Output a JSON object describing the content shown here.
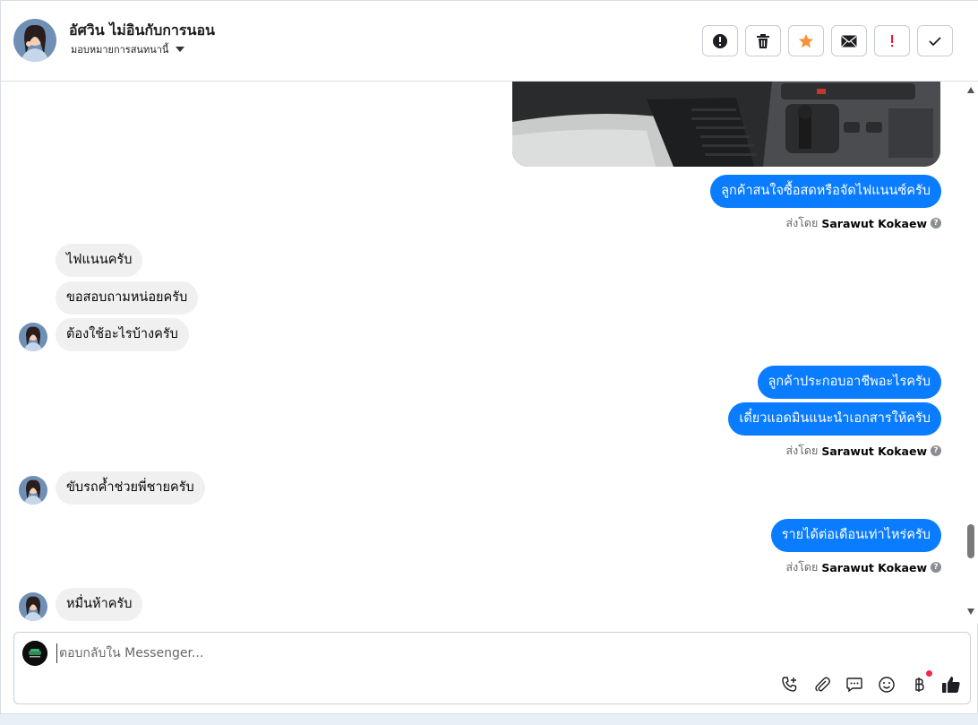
{
  "header": {
    "contact_name": "อัศวิน ไม่อินกับการนอน",
    "assign_label": "มอบหมายการสนทนานี้",
    "actions": [
      {
        "name": "spam-button",
        "icon": "alert-circle-icon"
      },
      {
        "name": "delete-button",
        "icon": "trash-icon"
      },
      {
        "name": "star-button",
        "icon": "star-icon"
      },
      {
        "name": "mark-unread-button",
        "icon": "envelope-icon"
      },
      {
        "name": "important-button",
        "icon": "exclamation-icon"
      },
      {
        "name": "done-button",
        "icon": "check-icon"
      }
    ]
  },
  "messages": {
    "m1": "ลูกค้าสนใจซื้อสดหรือจัดไฟแนนซ์ครับ",
    "m2": "ไฟแนนครับ",
    "m3": "ขอสอบถามหน่อยครับ",
    "m4": "ต้องใช้อะไรบ้างครับ",
    "m5": "ลูกค้าประกอบอาชีพอะไรครับ",
    "m6": "เดี๋ยวแอดมินแนะนำเอกสารให้ครับ",
    "m7": "ขับรถค้ำช่วยพี่ชายครับ",
    "m8": "รายได้ต่อเดือนเท่าไหร่ครับ",
    "m9": "หมื่นห้าครับ"
  },
  "sent_by": {
    "prefix": "ส่งโดย",
    "agent": "Sarawut Kokaew"
  },
  "composer": {
    "placeholder": "ตอบกลับใน Messenger..."
  },
  "colors": {
    "outgoing_bubble": "#0a7cff",
    "incoming_bubble": "#f0f0f0",
    "star": "#f7923a",
    "important": "#e41e3f"
  }
}
